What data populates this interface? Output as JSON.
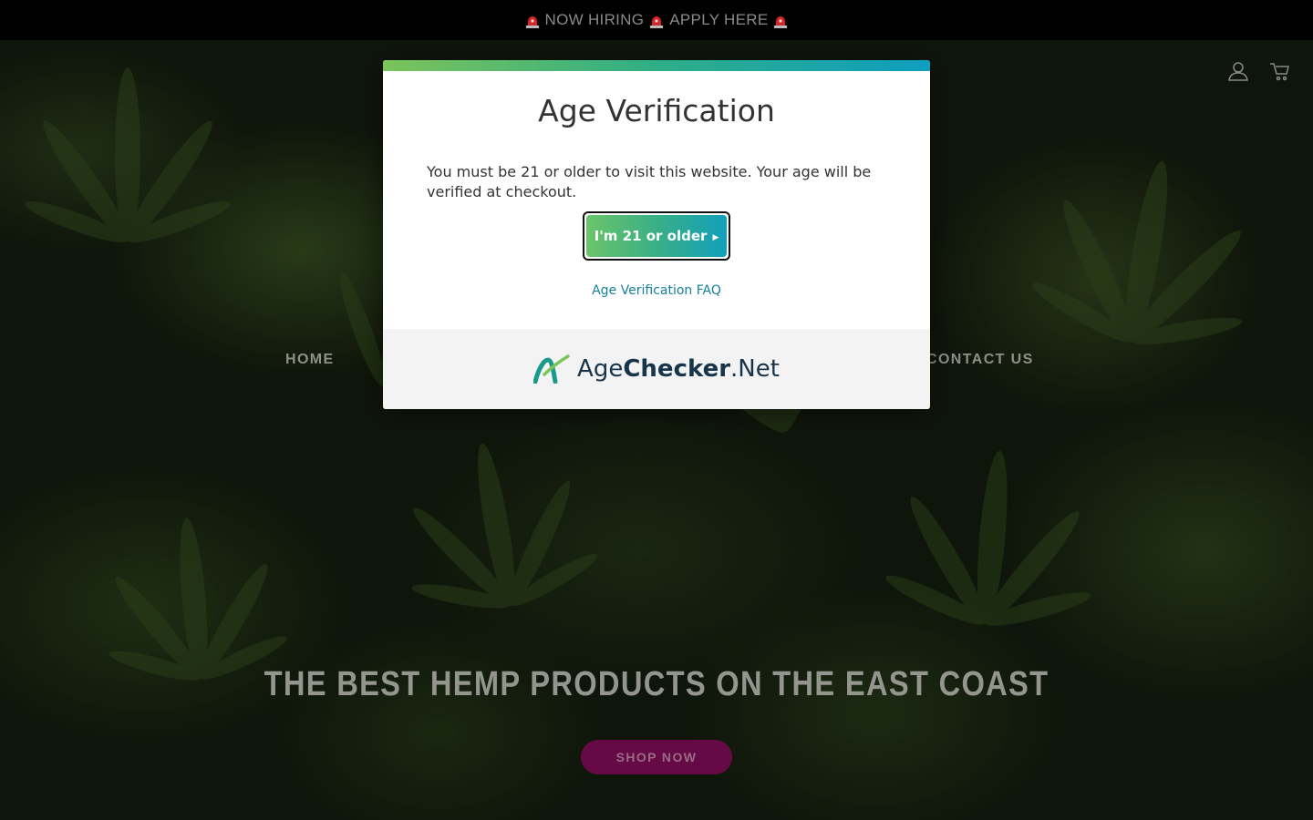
{
  "announcement": {
    "text": "NOW HIRING",
    "link": "APPLY HERE",
    "icon": "siren-icon"
  },
  "header": {
    "account_icon": "user-icon",
    "cart_icon": "cart-icon"
  },
  "nav": {
    "home": "HOME",
    "contact": "CONTACT US"
  },
  "hero": {
    "title": "THE BEST HEMP PRODUCTS ON THE EAST COAST",
    "button": "SHOP NOW"
  },
  "modal": {
    "title": "Age Verification",
    "message": "You must be 21 or older to visit this website. Your age will be verified at checkout.",
    "confirm_label": "I'm 21 or older",
    "faq_link": "Age Verification FAQ",
    "brand_prefix": "Age",
    "brand_bold": "Checker",
    "brand_suffix": ".Net"
  },
  "colors": {
    "accent_green": "#6ac46a",
    "accent_teal": "#12a0bb",
    "shop_button": "#660a45"
  }
}
